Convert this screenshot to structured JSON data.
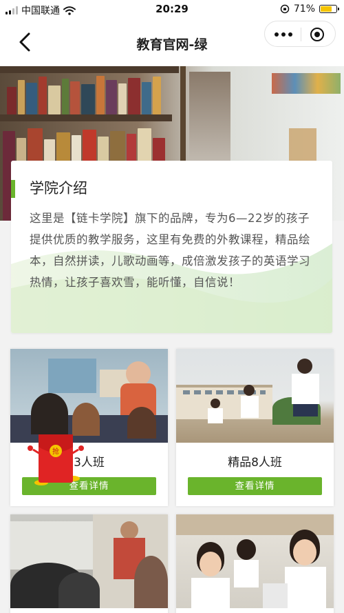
{
  "status_bar": {
    "carrier": "中国联通",
    "time": "20:29",
    "battery": "71%",
    "battery_level": 0.71
  },
  "nav": {
    "title": "教育官网-绿"
  },
  "intro": {
    "title": "学院介绍",
    "text": "这里是【链卡学院】旗下的品牌，专为6—22岁的孩子提供优质的教学服务，这里有免费的外教课程，精品绘本，自然拼读，儿歌动画等，成倍激发孩子的英语学习热情，让孩子喜欢雪，能听懂，自信说！"
  },
  "classes": [
    {
      "name": "3人班",
      "button": "查看详情"
    },
    {
      "name": "精品8人班",
      "button": "查看详情"
    },
    {
      "name": "",
      "button": ""
    },
    {
      "name": "",
      "button": ""
    }
  ],
  "red_packet": {
    "label": "抢"
  },
  "colors": {
    "accent": "#6ab42c",
    "packet_red": "#e02424",
    "packet_gold": "#f5c400"
  }
}
